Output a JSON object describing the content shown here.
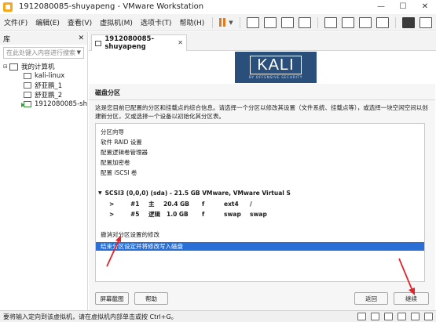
{
  "window": {
    "title": "1912080085-shuyapeng - VMware Workstation",
    "minimize": "—",
    "maximize": "☐",
    "close": "✕"
  },
  "menu": {
    "items": [
      "文件(F)",
      "编辑(E)",
      "查看(V)",
      "虚拟机(M)",
      "选项卡(T)",
      "帮助(H)"
    ]
  },
  "library": {
    "title": "库",
    "close": "✕",
    "search_placeholder": "在此处键入内容进行搜索",
    "root": "我的计算机",
    "items": [
      "kali-linux",
      "舒亚鹏_1",
      "舒亚鹏_2",
      "1912080085-sh"
    ]
  },
  "vm_tab": {
    "label": "1912080085-shuyapeng",
    "close": "✕"
  },
  "installer": {
    "logo": "KALI",
    "logo_sub": "BY OFFENSIVE SECURITY",
    "section_title": "磁盘分区",
    "description": "这是您目前已配置的分区和挂载点的综合信息。请选择一个分区以修改其设置（文件系统、挂载点等），或选择一块空闲空间以创建新分区，又或选择一个设备以初始化其分区表。",
    "menu_items": [
      "分区向导",
      "软件 RAID 设置",
      "配置逻辑卷管理器",
      "配置加密卷",
      "配置 iSCSI 卷"
    ],
    "disk": "SCSI3 (0,0,0) (sda) - 21.5 GB VMware, VMware Virtual S",
    "partitions": [
      {
        "marker": ">",
        "num": "#1",
        "type": "主",
        "size": "20.4 GB",
        "flag": "f",
        "fs": "ext4",
        "mount": "/"
      },
      {
        "marker": ">",
        "num": "#5",
        "type": "逻辑",
        "size": "1.0 GB",
        "flag": "f",
        "fs": "swap",
        "mount": "swap"
      }
    ],
    "undo": "撤消对分区设置的修改",
    "finish": "结束分区设定并将修改写入磁盘",
    "buttons": {
      "screenshot": "屏幕截图",
      "help": "帮助",
      "back": "返回",
      "continue": "继续"
    }
  },
  "statusbar": {
    "text": "要将输入定向到该虚拟机，请在虚拟机内部单击或按 Ctrl+G。"
  },
  "colors": {
    "kali_blue": "#2a4f7a",
    "selection": "#2a6fd6",
    "pause": "#e07a1f",
    "annotation_arrow": "#e3242b"
  }
}
